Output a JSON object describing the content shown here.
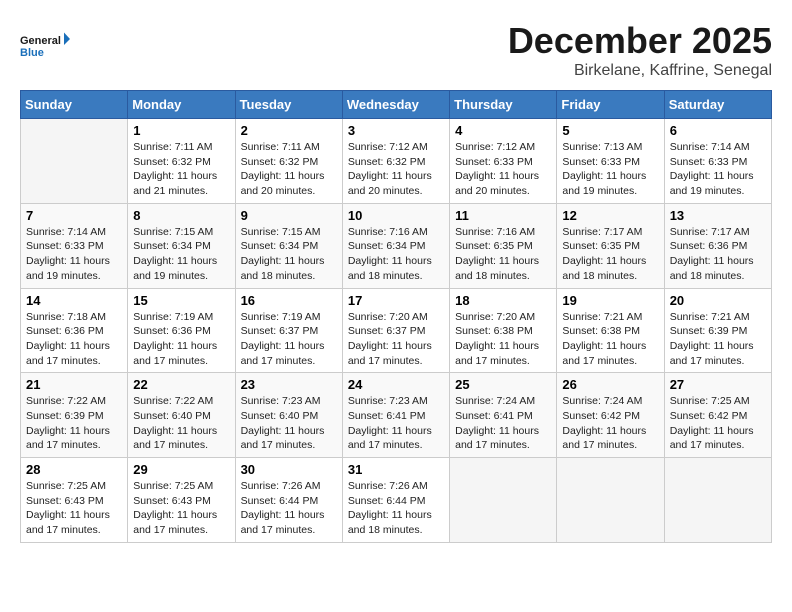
{
  "logo": {
    "line1": "General",
    "line2": "Blue"
  },
  "title": "December 2025",
  "location": "Birkelane, Kaffrine, Senegal",
  "days_header": [
    "Sunday",
    "Monday",
    "Tuesday",
    "Wednesday",
    "Thursday",
    "Friday",
    "Saturday"
  ],
  "weeks": [
    [
      {
        "num": "",
        "info": ""
      },
      {
        "num": "1",
        "info": "Sunrise: 7:11 AM\nSunset: 6:32 PM\nDaylight: 11 hours\nand 21 minutes."
      },
      {
        "num": "2",
        "info": "Sunrise: 7:11 AM\nSunset: 6:32 PM\nDaylight: 11 hours\nand 20 minutes."
      },
      {
        "num": "3",
        "info": "Sunrise: 7:12 AM\nSunset: 6:32 PM\nDaylight: 11 hours\nand 20 minutes."
      },
      {
        "num": "4",
        "info": "Sunrise: 7:12 AM\nSunset: 6:33 PM\nDaylight: 11 hours\nand 20 minutes."
      },
      {
        "num": "5",
        "info": "Sunrise: 7:13 AM\nSunset: 6:33 PM\nDaylight: 11 hours\nand 19 minutes."
      },
      {
        "num": "6",
        "info": "Sunrise: 7:14 AM\nSunset: 6:33 PM\nDaylight: 11 hours\nand 19 minutes."
      }
    ],
    [
      {
        "num": "7",
        "info": "Sunrise: 7:14 AM\nSunset: 6:33 PM\nDaylight: 11 hours\nand 19 minutes."
      },
      {
        "num": "8",
        "info": "Sunrise: 7:15 AM\nSunset: 6:34 PM\nDaylight: 11 hours\nand 19 minutes."
      },
      {
        "num": "9",
        "info": "Sunrise: 7:15 AM\nSunset: 6:34 PM\nDaylight: 11 hours\nand 18 minutes."
      },
      {
        "num": "10",
        "info": "Sunrise: 7:16 AM\nSunset: 6:34 PM\nDaylight: 11 hours\nand 18 minutes."
      },
      {
        "num": "11",
        "info": "Sunrise: 7:16 AM\nSunset: 6:35 PM\nDaylight: 11 hours\nand 18 minutes."
      },
      {
        "num": "12",
        "info": "Sunrise: 7:17 AM\nSunset: 6:35 PM\nDaylight: 11 hours\nand 18 minutes."
      },
      {
        "num": "13",
        "info": "Sunrise: 7:17 AM\nSunset: 6:36 PM\nDaylight: 11 hours\nand 18 minutes."
      }
    ],
    [
      {
        "num": "14",
        "info": "Sunrise: 7:18 AM\nSunset: 6:36 PM\nDaylight: 11 hours\nand 17 minutes."
      },
      {
        "num": "15",
        "info": "Sunrise: 7:19 AM\nSunset: 6:36 PM\nDaylight: 11 hours\nand 17 minutes."
      },
      {
        "num": "16",
        "info": "Sunrise: 7:19 AM\nSunset: 6:37 PM\nDaylight: 11 hours\nand 17 minutes."
      },
      {
        "num": "17",
        "info": "Sunrise: 7:20 AM\nSunset: 6:37 PM\nDaylight: 11 hours\nand 17 minutes."
      },
      {
        "num": "18",
        "info": "Sunrise: 7:20 AM\nSunset: 6:38 PM\nDaylight: 11 hours\nand 17 minutes."
      },
      {
        "num": "19",
        "info": "Sunrise: 7:21 AM\nSunset: 6:38 PM\nDaylight: 11 hours\nand 17 minutes."
      },
      {
        "num": "20",
        "info": "Sunrise: 7:21 AM\nSunset: 6:39 PM\nDaylight: 11 hours\nand 17 minutes."
      }
    ],
    [
      {
        "num": "21",
        "info": "Sunrise: 7:22 AM\nSunset: 6:39 PM\nDaylight: 11 hours\nand 17 minutes."
      },
      {
        "num": "22",
        "info": "Sunrise: 7:22 AM\nSunset: 6:40 PM\nDaylight: 11 hours\nand 17 minutes."
      },
      {
        "num": "23",
        "info": "Sunrise: 7:23 AM\nSunset: 6:40 PM\nDaylight: 11 hours\nand 17 minutes."
      },
      {
        "num": "24",
        "info": "Sunrise: 7:23 AM\nSunset: 6:41 PM\nDaylight: 11 hours\nand 17 minutes."
      },
      {
        "num": "25",
        "info": "Sunrise: 7:24 AM\nSunset: 6:41 PM\nDaylight: 11 hours\nand 17 minutes."
      },
      {
        "num": "26",
        "info": "Sunrise: 7:24 AM\nSunset: 6:42 PM\nDaylight: 11 hours\nand 17 minutes."
      },
      {
        "num": "27",
        "info": "Sunrise: 7:25 AM\nSunset: 6:42 PM\nDaylight: 11 hours\nand 17 minutes."
      }
    ],
    [
      {
        "num": "28",
        "info": "Sunrise: 7:25 AM\nSunset: 6:43 PM\nDaylight: 11 hours\nand 17 minutes."
      },
      {
        "num": "29",
        "info": "Sunrise: 7:25 AM\nSunset: 6:43 PM\nDaylight: 11 hours\nand 17 minutes."
      },
      {
        "num": "30",
        "info": "Sunrise: 7:26 AM\nSunset: 6:44 PM\nDaylight: 11 hours\nand 17 minutes."
      },
      {
        "num": "31",
        "info": "Sunrise: 7:26 AM\nSunset: 6:44 PM\nDaylight: 11 hours\nand 18 minutes."
      },
      {
        "num": "",
        "info": ""
      },
      {
        "num": "",
        "info": ""
      },
      {
        "num": "",
        "info": ""
      }
    ]
  ]
}
